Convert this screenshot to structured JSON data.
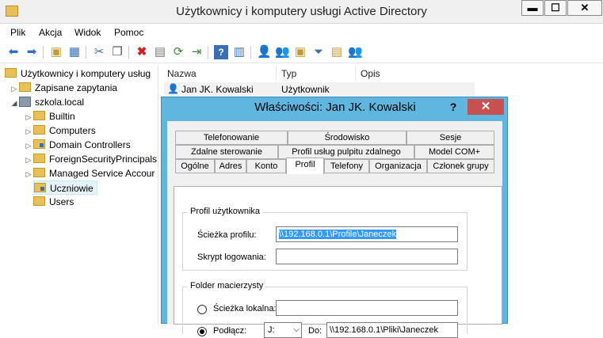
{
  "window": {
    "title": "Użytkownicy i komputery usługi Active Directory",
    "minimize": "▬",
    "maximize": "☐",
    "close": "✕"
  },
  "menu": [
    "Plik",
    "Akcja",
    "Widok",
    "Pomoc"
  ],
  "toolbar_icons": [
    "back-arrow-icon",
    "forward-arrow-icon",
    "up-folder-icon",
    "console-tree-icon",
    "cut-icon",
    "copy-icon",
    "delete-icon",
    "properties-icon",
    "refresh-icon",
    "export-list-icon",
    "help-icon",
    "console-icon",
    "new-user-icon",
    "new-group-icon",
    "new-ou-icon",
    "filter-icon",
    "find-icon",
    "add-to-group-icon"
  ],
  "tree": {
    "root": "Użytkownicy i komputery usług",
    "saved_queries": "Zapisane zapytania",
    "domain": "szkola.local",
    "children": [
      "Builtin",
      "Computers",
      "Domain Controllers",
      "ForeignSecurityPrincipals",
      "Managed Service Accour",
      "Uczniowie",
      "Users"
    ],
    "selected": "Uczniowie"
  },
  "list": {
    "columns": [
      "Nazwa",
      "Typ",
      "Opis"
    ],
    "rows": [
      {
        "name": "Jan JK. Kowalski",
        "type": "Użytkownik",
        "desc": ""
      }
    ]
  },
  "dialog": {
    "title": "Właściwości: Jan JK. Kowalski",
    "help": "?",
    "close": "✕",
    "tabs_row1": [
      "Telefonowanie",
      "Środowisko",
      "Sesje"
    ],
    "tabs_row2": [
      "Zdalne sterowanie",
      "Profil usług pulpitu zdalnego",
      "Model COM+"
    ],
    "tabs_row3": [
      "Ogólne",
      "Adres",
      "Konto",
      "Profil",
      "Telefony",
      "Organizacja",
      "Członek grupy"
    ],
    "active_tab": "Profil",
    "profile_group": {
      "title": "Profil użytkownika",
      "profile_path_label": "Ścieżka profilu:",
      "profile_path_value": "\\\\192.168.0.1\\Profile\\Janeczek",
      "logon_script_label": "Skrypt logowania:",
      "logon_script_value": ""
    },
    "home_group": {
      "title": "Folder macierzysty",
      "local_path_label": "Ścieżka lokalna:",
      "local_path_value": "",
      "connect_label": "Podłącz:",
      "drive_value": "J:",
      "to_label": "Do:",
      "to_value": "\\\\192.168.0.1\\Pliki\\Janeczek",
      "selected_option": "connect"
    }
  }
}
